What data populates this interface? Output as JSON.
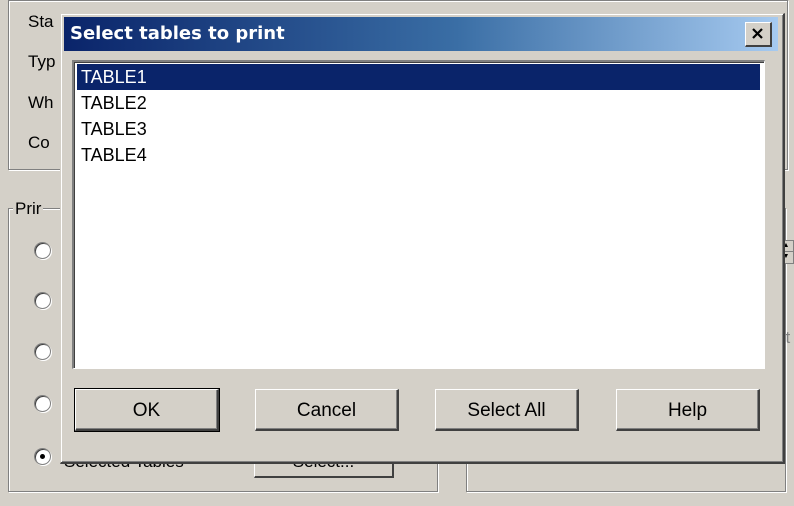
{
  "background": {
    "labels": {
      "sta": "Sta",
      "typ": "Typ",
      "wh": "Wh",
      "co": "Co",
      "prin": "Prir",
      "at": "at"
    },
    "selected_tables_label": "Selected Tables",
    "select_button": "Select..."
  },
  "dialog": {
    "title": "Select tables to print",
    "close_glyph": "✕",
    "tables": [
      {
        "label": "TABLE1",
        "selected": true
      },
      {
        "label": "TABLE2",
        "selected": false
      },
      {
        "label": "TABLE3",
        "selected": false
      },
      {
        "label": "TABLE4",
        "selected": false
      }
    ],
    "buttons": {
      "ok": "OK",
      "cancel": "Cancel",
      "select_all": "Select All",
      "help": "Help"
    }
  },
  "colors": {
    "selection": "#0a246a",
    "face": "#d4d0c8"
  }
}
